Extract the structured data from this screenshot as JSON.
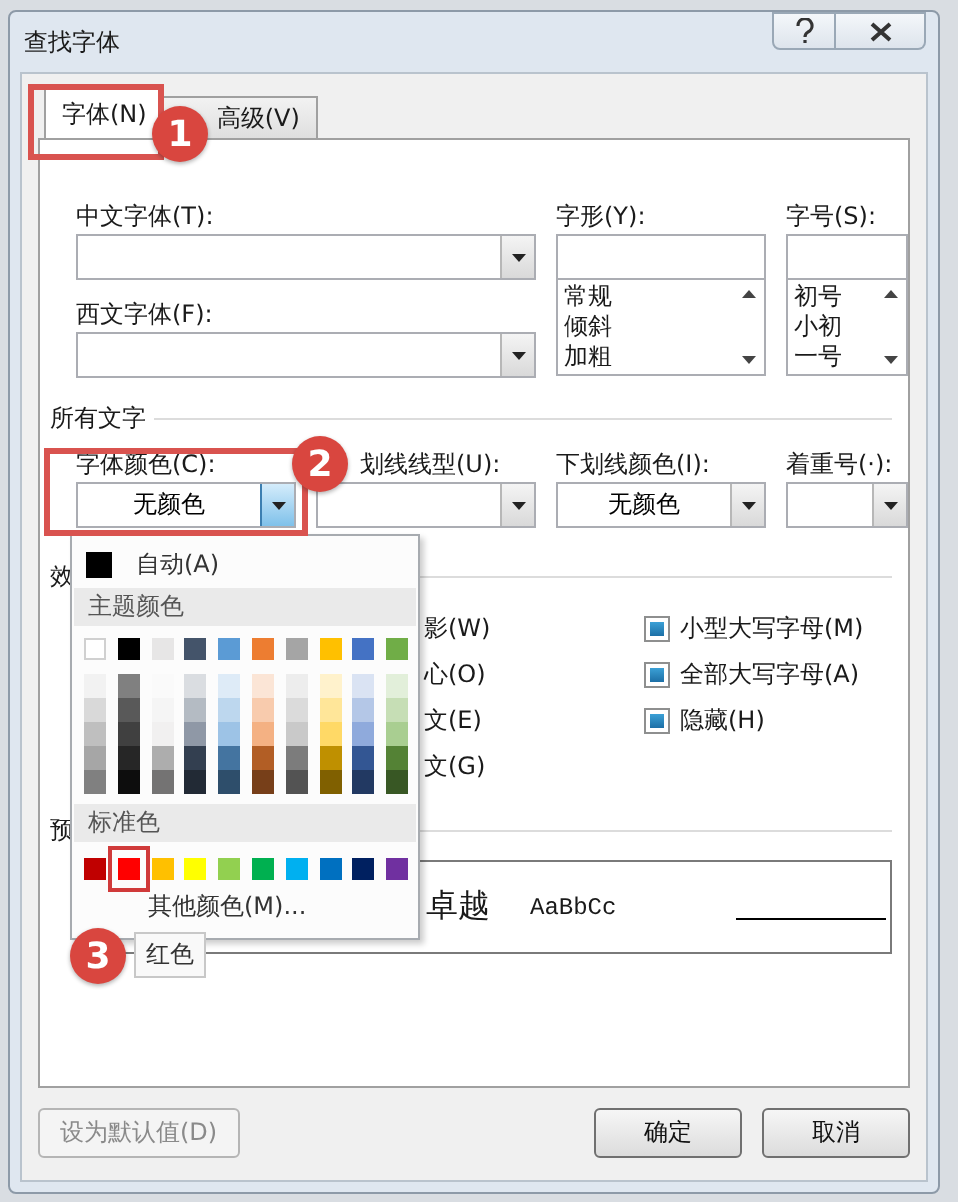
{
  "window": {
    "title": "查找字体"
  },
  "tabs": [
    {
      "label": "字体(N)",
      "selected": true
    },
    {
      "label": "高级(V)",
      "selected": false
    }
  ],
  "font": {
    "chinese_font": {
      "label": "中文字体(T):"
    },
    "western_font": {
      "label": "西文字体(F):"
    },
    "style": {
      "label": "字形(Y):",
      "options": [
        "常规",
        "倾斜",
        "加粗"
      ]
    },
    "size": {
      "label": "字号(S):",
      "options": [
        "初号",
        "小初",
        "一号"
      ]
    }
  },
  "all_text": {
    "title": "所有文字",
    "fields": [
      {
        "label": "字体颜色(C):",
        "value": "无颜色",
        "expanded": true
      },
      {
        "label": "划线线型(U):",
        "expanded": false
      },
      {
        "label": "下划线颜色(I):",
        "value": "无颜色",
        "expanded": false
      },
      {
        "label": "着重号(·):",
        "expanded": false
      }
    ]
  },
  "effects": {
    "title": "效",
    "middle": [
      "影(W)",
      "心(O)",
      "文(E)",
      "文(G)"
    ],
    "right": [
      {
        "label": "小型大写字母(M)",
        "indeterminate": true
      },
      {
        "label": "全部大写字母(A)",
        "indeterminate": true
      },
      {
        "label": "隐藏(H)",
        "indeterminate": true
      }
    ]
  },
  "preview": {
    "title": "预",
    "sample_chinese": "卓越",
    "sample_latin": "AaBbCc"
  },
  "buttons": [
    {
      "label": "设为默认值(D)",
      "disabled": true
    },
    {
      "label": "确定",
      "disabled": false
    },
    {
      "label": "取消",
      "disabled": false
    }
  ],
  "color_menu": {
    "automatic": "自动(A)",
    "theme_title": "主题颜色",
    "theme_colors": [
      {
        "color": "#ffffff"
      },
      {
        "color": "#000000"
      },
      {
        "color": "#e7e6e6"
      },
      {
        "color": "#44546a"
      },
      {
        "color": "#5b9bd5"
      },
      {
        "color": "#ed7d31"
      },
      {
        "color": "#a5a5a5"
      },
      {
        "color": "#ffc000"
      },
      {
        "color": "#4472c4"
      },
      {
        "color": "#70ad47"
      }
    ],
    "standard_title": "标准色",
    "standard_colors": [
      {
        "color": "#c00000",
        "selected": false
      },
      {
        "color": "#ff0000",
        "selected": true
      },
      {
        "color": "#ffc000",
        "selected": false
      },
      {
        "color": "#ffff00",
        "selected": false
      },
      {
        "color": "#92d050",
        "selected": false
      },
      {
        "color": "#00b050",
        "selected": false
      },
      {
        "color": "#00b0f0",
        "selected": false
      },
      {
        "color": "#0070c0",
        "selected": false
      },
      {
        "color": "#002060",
        "selected": false
      },
      {
        "color": "#7030a0",
        "selected": false
      }
    ],
    "more": "其他颜色(M)...",
    "tooltip": "红色"
  },
  "callouts": [
    "1",
    "2",
    "3"
  ]
}
